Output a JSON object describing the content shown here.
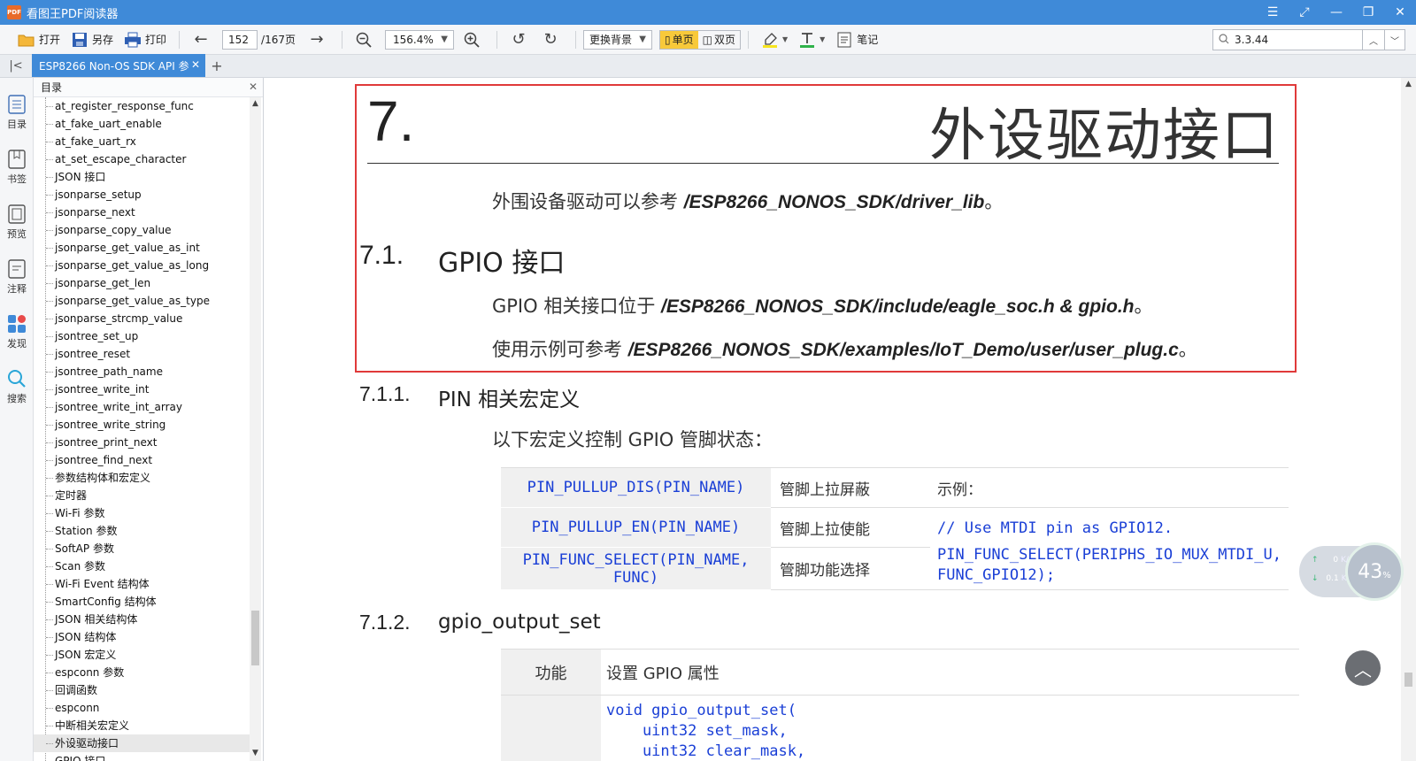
{
  "window": {
    "logo_text": "PDF",
    "title": "看图王PDF阅读器",
    "controls": [
      "☰",
      "⤢",
      "—",
      "❐",
      "✕"
    ]
  },
  "toolbar": {
    "open": "打开",
    "save_as": "另存",
    "print": "打印",
    "page_current": "152",
    "page_total": "/167页",
    "zoom": "156.4%",
    "background": "更换背景",
    "single_page": "单页",
    "double_page": "双页",
    "notes": "笔记",
    "search_value": "3.3.44"
  },
  "tabs": {
    "doc_tab": "ESP8266 Non-OS SDK API 参",
    "close": "✕",
    "add": "+"
  },
  "rail": [
    {
      "label": "目录",
      "icon": "toc-icon"
    },
    {
      "label": "书签",
      "icon": "bookmark-icon"
    },
    {
      "label": "预览",
      "icon": "preview-icon"
    },
    {
      "label": "注释",
      "icon": "annotation-icon"
    },
    {
      "label": "发现",
      "icon": "discover-icon"
    },
    {
      "label": "搜索",
      "icon": "search-icon"
    }
  ],
  "toc": {
    "title": "目录",
    "items": [
      "at_register_response_func",
      "at_fake_uart_enable",
      "at_fake_uart_rx",
      "at_set_escape_character",
      "JSON 接口",
      "jsonparse_setup",
      "jsonparse_next",
      "jsonparse_copy_value",
      "jsonparse_get_value_as_int",
      "jsonparse_get_value_as_long",
      "jsonparse_get_len",
      "jsonparse_get_value_as_type",
      "jsonparse_strcmp_value",
      "jsontree_set_up",
      "jsontree_reset",
      "jsontree_path_name",
      "jsontree_write_int",
      "jsontree_write_int_array",
      "jsontree_write_string",
      "jsontree_print_next",
      "jsontree_find_next",
      "参数结构体和宏定义",
      "定时器",
      "Wi-Fi 参数",
      "Station 参数",
      "SoftAP 参数",
      "Scan 参数",
      "Wi-Fi Event 结构体",
      "SmartConfig 结构体",
      "JSON 相关结构体",
      "JSON 结构体",
      "JSON 宏定义",
      "espconn 参数",
      "回调函数",
      "espconn",
      "中断相关宏定义",
      "外设驱动接口",
      "GPIO 接口"
    ],
    "selected_index": 36
  },
  "document": {
    "chapter_num": "7.",
    "chapter_title": "外设驱动接口",
    "intro_text": "外围设备驱动可以参考 ",
    "intro_path": "/ESP8266_NONOS_SDK/driver_lib",
    "intro_end": "。",
    "sec_num": "7.1.",
    "sec_title": "GPIO 接口",
    "gpio_text": "GPIO 相关接口位于 ",
    "gpio_path": "/ESP8266_NONOS_SDK/include/eagle_soc.h & gpio.h",
    "gpio_end": "。",
    "example_text": "使用示例可参考 ",
    "example_path": "/ESP8266_NONOS_SDK/examples/IoT_Demo/user/user_plug.c",
    "example_end": "。",
    "sub1_num": "7.1.1.",
    "sub1_title": "PIN 相关宏定义",
    "sub1_text": "以下宏定义控制 GPIO 管脚状态：",
    "macros": [
      {
        "name": "PIN_PULLUP_DIS(PIN_NAME)",
        "desc": "管脚上拉屏蔽"
      },
      {
        "name": "PIN_PULLUP_EN(PIN_NAME)",
        "desc": "管脚上拉使能"
      },
      {
        "name": "PIN_FUNC_SELECT(PIN_NAME, FUNC)",
        "desc": "管脚功能选择"
      }
    ],
    "example_label": "示例：",
    "example_comment": "// Use MTDI pin as GPIO12.",
    "example_code_1": "PIN_FUNC_SELECT(PERIPHS_IO_MUX_MTDI_U,",
    "example_code_2": "FUNC_GPIO12);",
    "sub2_num": "7.1.2.",
    "sub2_title": "gpio_output_set",
    "fn_label": "功能",
    "fn_value": "设置 GPIO 属性",
    "code_line_1": "void gpio_output_set(",
    "code_line_2": "    uint32 set_mask,",
    "code_line_3": "    uint32 clear_mask,"
  },
  "widgets": {
    "up_speed": "0",
    "up_unit": "K/s",
    "down_speed": "0.1",
    "down_unit": "K/s",
    "percent": "43",
    "percent_sign": "%",
    "back_to_top": "︿"
  },
  "colors": {
    "accent": "#3f8ad8",
    "highlight_border": "#e03a3a",
    "code_blue": "#1a3fd6",
    "active_view": "#f8c93a"
  }
}
